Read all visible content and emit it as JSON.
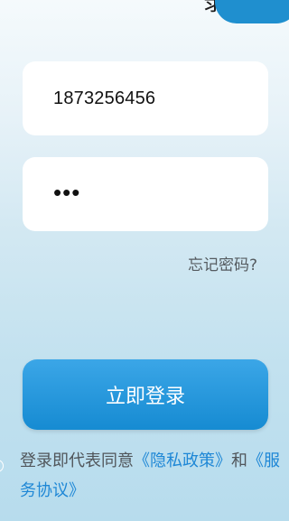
{
  "header": {
    "title_fragment": "录"
  },
  "form": {
    "phone_value": "1873256456",
    "password_mask": "•••",
    "forgot_password": "忘记密码?",
    "login_button": "立即登录"
  },
  "agreement": {
    "prefix": "登录即代表同意",
    "privacy_policy": "《隐私政策》",
    "conjunction": "和",
    "service_agreement": "《服务协议》"
  },
  "colors": {
    "accent": "#1E87D6",
    "button": "#1F8FD1",
    "field_background": "#FFFFFF"
  }
}
